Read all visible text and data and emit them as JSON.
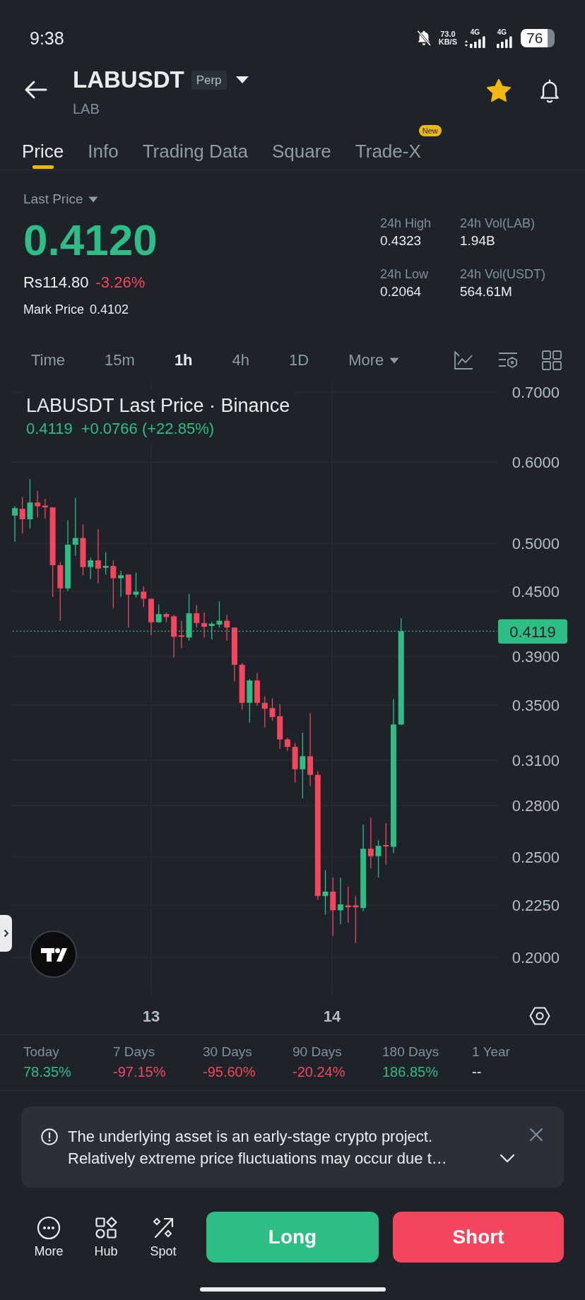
{
  "status_bar": {
    "time": "9:38",
    "network_speed": {
      "value": "73.0",
      "unit": "KB/S"
    },
    "signals": [
      {
        "label": "4G"
      },
      {
        "label": "4G"
      }
    ],
    "battery": "76"
  },
  "header": {
    "symbol": "LABUSDT",
    "contract_type": "Perp",
    "base_asset": "LAB",
    "favorite": true
  },
  "tabs": [
    {
      "label": "Price",
      "selected": true
    },
    {
      "label": "Info",
      "selected": false
    },
    {
      "label": "Trading Data",
      "selected": false
    },
    {
      "label": "Square",
      "selected": false
    },
    {
      "label": "Trade-X",
      "selected": false,
      "badge": "New"
    }
  ],
  "price": {
    "label": "Last Price",
    "last": "0.4120",
    "last_rising": true,
    "fiat": "Rs114.80",
    "change": "-3.26%",
    "change_rising": false,
    "mark_label": "Mark Price",
    "mark": "0.4102"
  },
  "stats": [
    {
      "label": "24h High",
      "value": "0.4323"
    },
    {
      "label": "24h Vol(LAB)",
      "value": "1.94B"
    },
    {
      "label": "24h Low",
      "value": "0.2064"
    },
    {
      "label": "24h Vol(USDT)",
      "value": "564.61M"
    }
  ],
  "intervals": [
    {
      "label": "Time",
      "kind": "interval",
      "selected": false
    },
    {
      "label": "15m",
      "kind": "interval",
      "selected": false
    },
    {
      "label": "1h",
      "kind": "interval",
      "selected": true
    },
    {
      "label": "4h",
      "kind": "interval",
      "selected": false
    },
    {
      "label": "1D",
      "kind": "interval",
      "selected": false
    },
    {
      "label": "More",
      "kind": "menu",
      "selected": false
    }
  ],
  "chart": {
    "title": "LABUSDT Last Price · Binance",
    "last": "0.4119",
    "change": "+0.0766 (+22.85%)",
    "rising": true,
    "price_axis": [
      "0.7000",
      "0.6000",
      "0.5000",
      "0.4500",
      "0.3900",
      "0.3500",
      "0.3100",
      "0.2800",
      "0.2500",
      "0.2250",
      "0.2000"
    ],
    "price_tag": "0.4119",
    "time_axis": [
      "13",
      "14"
    ]
  },
  "performance": [
    {
      "label": "Today",
      "value": "78.35%",
      "color": "#2ebd85"
    },
    {
      "label": "7 Days",
      "value": "-97.15%",
      "color": "#f6465d"
    },
    {
      "label": "30 Days",
      "value": "-95.60%",
      "color": "#f6465d"
    },
    {
      "label": "90 Days",
      "value": "-20.24%",
      "color": "#f6465d"
    },
    {
      "label": "180 Days",
      "value": "186.85%",
      "color": "#2ebd85"
    },
    {
      "label": "1 Year",
      "value": "--",
      "color": "#eaecef"
    }
  ],
  "notice": {
    "text": "The underlying asset is an early-stage crypto project. Relatively extreme price fluctuations may occur due t…",
    "expanded": false
  },
  "bottom_bar": {
    "actions": [
      {
        "label": "More"
      },
      {
        "label": "Hub"
      },
      {
        "label": "Spot"
      }
    ],
    "trade_buttons": [
      {
        "label": "Long",
        "color": "#2ebd85"
      },
      {
        "label": "Short",
        "color": "#f6465d"
      }
    ]
  }
}
